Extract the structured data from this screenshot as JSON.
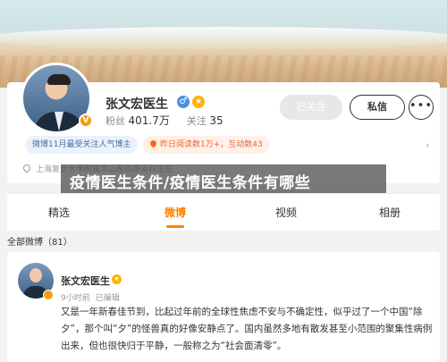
{
  "profile": {
    "name": "张文宏医生",
    "fans_label": "粉丝",
    "fans_count": "401.7万",
    "following_label": "关注",
    "following_count": "35",
    "followed_button": "已关注",
    "message_button": "私信",
    "more_button": "•••",
    "tag_rank": "微博11月最受关注人气博主",
    "tag_stats": "昨日阅读数1万+，互动数43",
    "location": "上海复旦大学附属华山医院感染科主任"
  },
  "overlay": {
    "title": "疫情医生条件/疫情医生条件有哪些"
  },
  "tabs": [
    {
      "label": "精选"
    },
    {
      "label": "微博"
    },
    {
      "label": "视频"
    },
    {
      "label": "相册"
    }
  ],
  "feed": {
    "all_label": "全部微博（81）"
  },
  "post": {
    "author": "张文宏医生",
    "time": "9小时前",
    "edited": "已编辑",
    "text": "又是一年新春佳节到，比起过年前的全球性焦虑不安与不确定性，似乎过了一个中国“除夕”，那个叫“夕”的怪兽真的好像安静点了。国内虽然多地有散发甚至小范围的聚集性病例出来，但也很快归于平静，一般称之为“社会面清零”。"
  },
  "colors": {
    "accent": "#ff8200",
    "overlay": "#464646"
  }
}
